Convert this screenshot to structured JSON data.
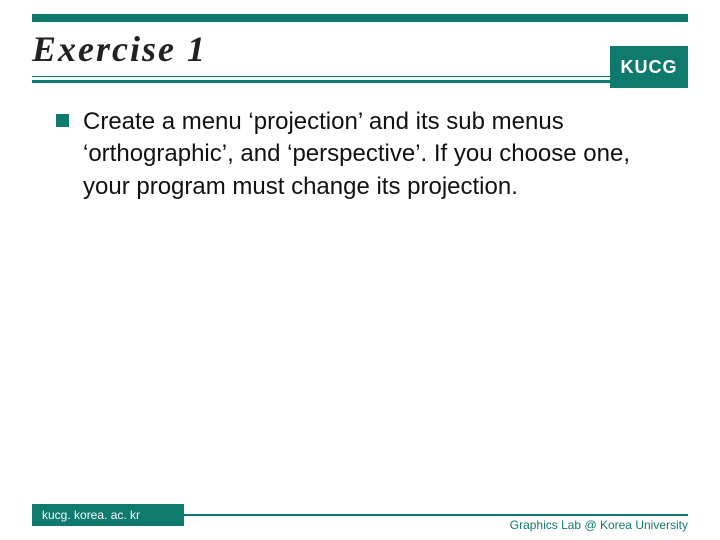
{
  "header": {
    "title": "Exercise 1",
    "logo": "KUCG"
  },
  "body": {
    "bullets": [
      {
        "text": "Create a menu ‘projection’ and its sub menus ‘orthographic’, and ‘perspective’. If you choose one, your program must change its projection."
      }
    ]
  },
  "footer": {
    "left": "kucg. korea. ac. kr",
    "right": "Graphics Lab @ Korea University"
  },
  "colors": {
    "accent": "#0f7a6e"
  }
}
